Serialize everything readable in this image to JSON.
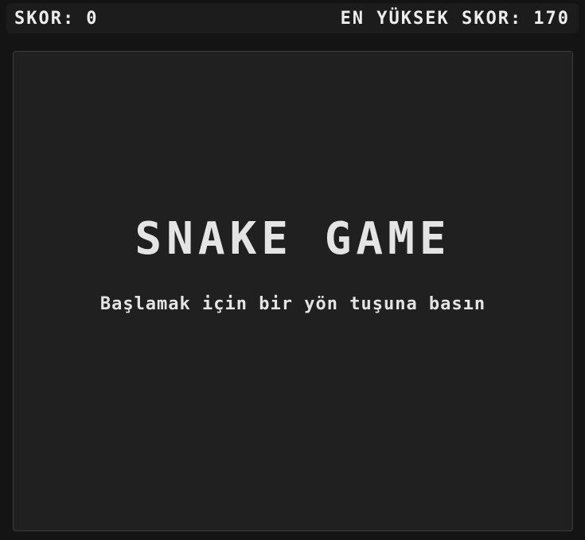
{
  "score": {
    "label": "SKOR:",
    "value": "0"
  },
  "high_score": {
    "label": "EN YÜKSEK SKOR:",
    "value": "170"
  },
  "board": {
    "title": "SNAKE GAME",
    "prompt": "Başlamak için bir yön tuşuna basın"
  }
}
